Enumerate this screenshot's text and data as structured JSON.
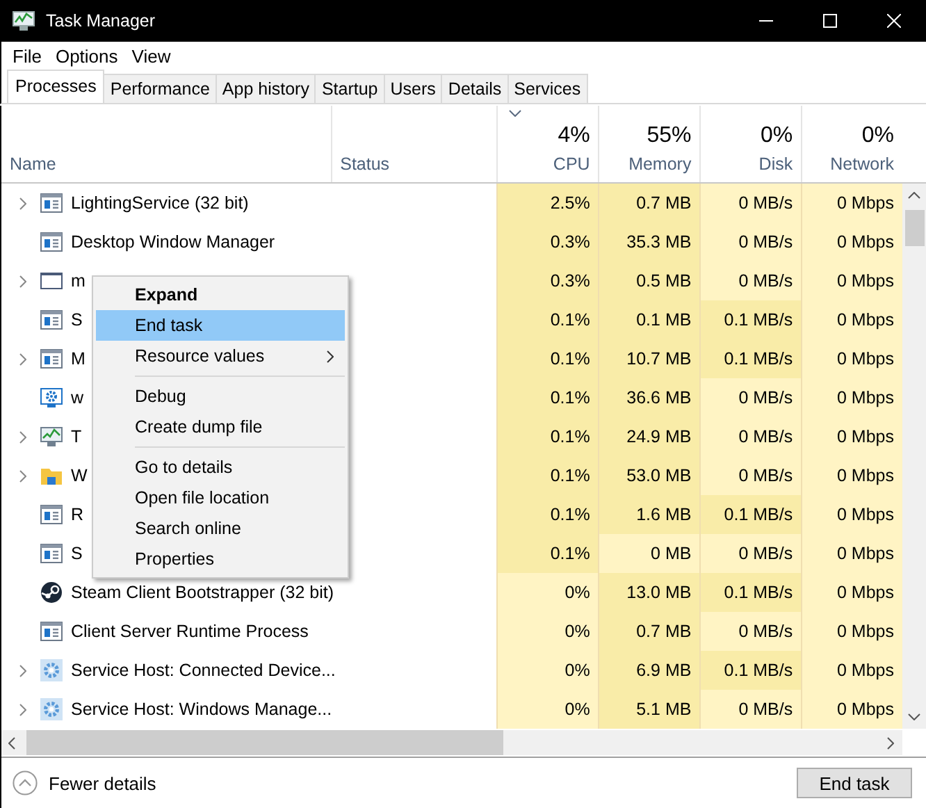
{
  "window": {
    "title": "Task Manager"
  },
  "menu_bar": [
    "File",
    "Options",
    "View"
  ],
  "tabs": [
    {
      "label": "Processes",
      "selected": true
    },
    {
      "label": "Performance",
      "selected": false
    },
    {
      "label": "App history",
      "selected": false
    },
    {
      "label": "Startup",
      "selected": false
    },
    {
      "label": "Users",
      "selected": false
    },
    {
      "label": "Details",
      "selected": false
    },
    {
      "label": "Services",
      "selected": false
    }
  ],
  "columns": [
    {
      "label": "Name"
    },
    {
      "label": "Status"
    },
    {
      "label": "CPU",
      "total": "4%",
      "sorted": true
    },
    {
      "label": "Memory",
      "total": "55%",
      "sorted": false
    },
    {
      "label": "Disk",
      "total": "0%",
      "sorted": false
    },
    {
      "label": "Network",
      "total": "0%",
      "sorted": false
    }
  ],
  "rows": [
    {
      "name": "LightingService (32 bit)",
      "kind": "app",
      "expandable": true,
      "cells": [
        {
          "text": "2.5%",
          "heat": true
        },
        {
          "text": "0.7 MB",
          "heat": true
        },
        {
          "text": "0 MB/s",
          "heat": false
        },
        {
          "text": "0 Mbps",
          "heat": false
        }
      ]
    },
    {
      "name": "Desktop Window Manager",
      "kind": "app",
      "expandable": false,
      "cells": [
        {
          "text": "0.3%",
          "heat": true
        },
        {
          "text": "35.3 MB",
          "heat": true
        },
        {
          "text": "0 MB/s",
          "heat": false
        },
        {
          "text": "0 Mbps",
          "heat": false
        }
      ]
    },
    {
      "name": "m",
      "kind": "window",
      "expandable": true,
      "cells": [
        {
          "text": "0.3%",
          "heat": true
        },
        {
          "text": "0.5 MB",
          "heat": true
        },
        {
          "text": "0 MB/s",
          "heat": false
        },
        {
          "text": "0 Mbps",
          "heat": false
        }
      ]
    },
    {
      "name": "S",
      "kind": "app",
      "expandable": false,
      "cells": [
        {
          "text": "0.1%",
          "heat": true
        },
        {
          "text": "0.1 MB",
          "heat": true
        },
        {
          "text": "0.1 MB/s",
          "heat": true
        },
        {
          "text": "0 Mbps",
          "heat": false
        }
      ]
    },
    {
      "name": "M",
      "kind": "app",
      "expandable": true,
      "cells": [
        {
          "text": "0.1%",
          "heat": true
        },
        {
          "text": "10.7 MB",
          "heat": true
        },
        {
          "text": "0.1 MB/s",
          "heat": true
        },
        {
          "text": "0 Mbps",
          "heat": false
        }
      ]
    },
    {
      "name": "w",
      "kind": "service",
      "expandable": false,
      "cells": [
        {
          "text": "0.1%",
          "heat": true
        },
        {
          "text": "36.6 MB",
          "heat": true
        },
        {
          "text": "0 MB/s",
          "heat": false
        },
        {
          "text": "0 Mbps",
          "heat": false
        }
      ]
    },
    {
      "name": "T",
      "kind": "monitor",
      "expandable": true,
      "cells": [
        {
          "text": "0.1%",
          "heat": true
        },
        {
          "text": "24.9 MB",
          "heat": true
        },
        {
          "text": "0 MB/s",
          "heat": false
        },
        {
          "text": "0 Mbps",
          "heat": false
        }
      ]
    },
    {
      "name": "W",
      "kind": "explorer",
      "expandable": true,
      "cells": [
        {
          "text": "0.1%",
          "heat": true
        },
        {
          "text": "53.0 MB",
          "heat": true
        },
        {
          "text": "0 MB/s",
          "heat": false
        },
        {
          "text": "0 Mbps",
          "heat": false
        }
      ]
    },
    {
      "name": "R",
      "kind": "app",
      "expandable": false,
      "cells": [
        {
          "text": "0.1%",
          "heat": true
        },
        {
          "text": "1.6 MB",
          "heat": true
        },
        {
          "text": "0.1 MB/s",
          "heat": true
        },
        {
          "text": "0 Mbps",
          "heat": false
        }
      ]
    },
    {
      "name": "S",
      "kind": "app",
      "expandable": false,
      "cells": [
        {
          "text": "0.1%",
          "heat": true
        },
        {
          "text": "0 MB",
          "heat": false
        },
        {
          "text": "0 MB/s",
          "heat": false
        },
        {
          "text": "0 Mbps",
          "heat": false
        }
      ]
    },
    {
      "name": "Steam Client Bootstrapper (32 bit)",
      "kind": "steam",
      "expandable": false,
      "cells": [
        {
          "text": "0%",
          "heat": false
        },
        {
          "text": "13.0 MB",
          "heat": true
        },
        {
          "text": "0.1 MB/s",
          "heat": true
        },
        {
          "text": "0 Mbps",
          "heat": false
        }
      ]
    },
    {
      "name": "Client Server Runtime Process",
      "kind": "app",
      "expandable": false,
      "cells": [
        {
          "text": "0%",
          "heat": false
        },
        {
          "text": "0.7 MB",
          "heat": true
        },
        {
          "text": "0 MB/s",
          "heat": false
        },
        {
          "text": "0 Mbps",
          "heat": false
        }
      ]
    },
    {
      "name": "Service Host: Connected Device...",
      "kind": "host",
      "expandable": true,
      "cells": [
        {
          "text": "0%",
          "heat": false
        },
        {
          "text": "6.9 MB",
          "heat": true
        },
        {
          "text": "0.1 MB/s",
          "heat": true
        },
        {
          "text": "0 Mbps",
          "heat": false
        }
      ]
    },
    {
      "name": "Service Host: Windows Manage...",
      "kind": "host",
      "expandable": true,
      "cells": [
        {
          "text": "0%",
          "heat": false
        },
        {
          "text": "5.1 MB",
          "heat": true
        },
        {
          "text": "0 MB/s",
          "heat": false
        },
        {
          "text": "0 Mbps",
          "heat": false
        }
      ]
    }
  ],
  "context_menu": {
    "groups": [
      [
        {
          "label": "Expand",
          "default": true,
          "selected": false,
          "submenu": false
        },
        {
          "label": "End task",
          "default": false,
          "selected": true,
          "submenu": false
        },
        {
          "label": "Resource values",
          "default": false,
          "selected": false,
          "submenu": true
        }
      ],
      [
        {
          "label": "Debug",
          "default": false,
          "selected": false,
          "submenu": false
        },
        {
          "label": "Create dump file",
          "default": false,
          "selected": false,
          "submenu": false
        }
      ],
      [
        {
          "label": "Go to details",
          "default": false,
          "selected": false,
          "submenu": false
        },
        {
          "label": "Open file location",
          "default": false,
          "selected": false,
          "submenu": false
        },
        {
          "label": "Search online",
          "default": false,
          "selected": false,
          "submenu": false
        },
        {
          "label": "Properties",
          "default": false,
          "selected": false,
          "submenu": false
        }
      ]
    ]
  },
  "footer": {
    "details_toggle": "Fewer details",
    "end_task_button": "End task"
  }
}
